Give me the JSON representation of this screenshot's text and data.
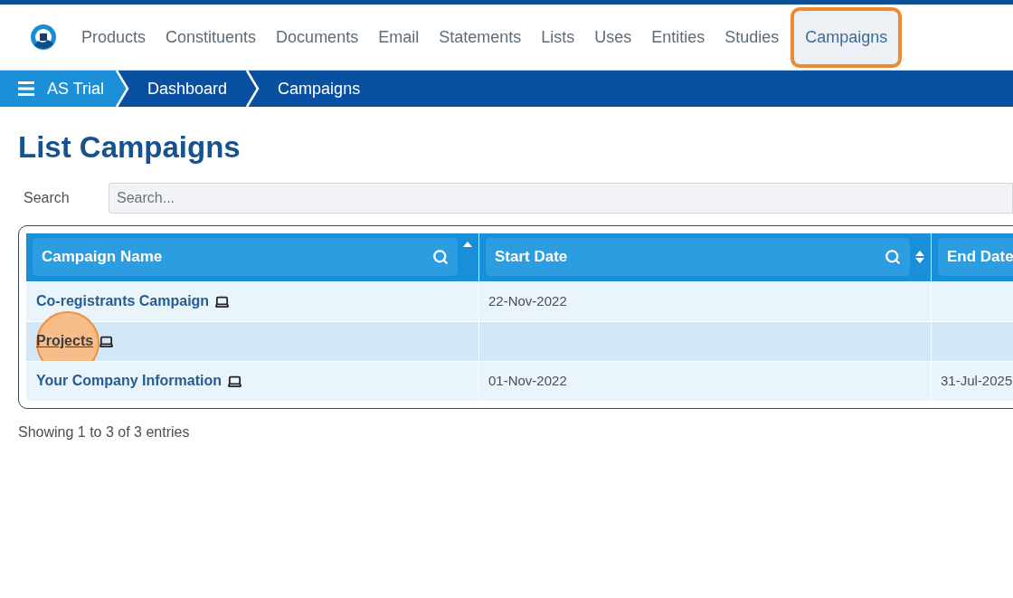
{
  "nav": {
    "items": [
      {
        "label": "Products",
        "selected": false
      },
      {
        "label": "Constituents",
        "selected": false
      },
      {
        "label": "Documents",
        "selected": false
      },
      {
        "label": "Email",
        "selected": false
      },
      {
        "label": "Statements",
        "selected": false
      },
      {
        "label": "Lists",
        "selected": false
      },
      {
        "label": "Uses",
        "selected": false
      },
      {
        "label": "Entities",
        "selected": false
      },
      {
        "label": "Studies",
        "selected": false
      },
      {
        "label": "Campaigns",
        "selected": true
      }
    ]
  },
  "breadcrumb": [
    {
      "label": "AS Trial",
      "kind": "home"
    },
    {
      "label": "Dashboard",
      "kind": "link"
    },
    {
      "label": "Campaigns",
      "kind": "current"
    }
  ],
  "page_title": "List Campaigns",
  "search": {
    "label": "Search",
    "placeholder": "Search..."
  },
  "table": {
    "columns": [
      {
        "label": "Campaign Name",
        "filter": true,
        "sorted_ascending": true
      },
      {
        "label": "Start Date",
        "filter": true,
        "sorted_ascending": false
      },
      {
        "label": "End Date"
      }
    ],
    "rows": [
      {
        "name": "Co-registrants Campaign",
        "start": "22-Nov-2022",
        "hovered": false
      },
      {
        "name": "Projects",
        "hovered": true
      },
      {
        "name": "Your Company Information",
        "start": "01-Nov-2022",
        "end": "31-Jul-2025",
        "hovered": false
      }
    ]
  },
  "status": "Showing 1 to 3 of 3 entries"
}
